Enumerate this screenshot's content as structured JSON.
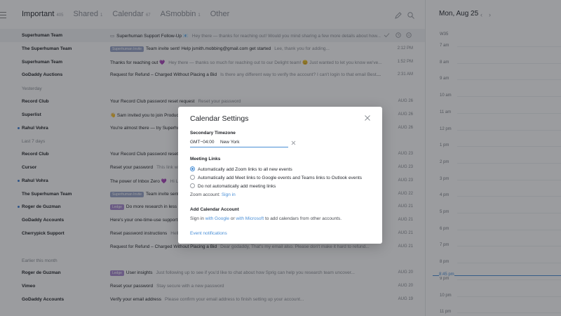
{
  "colors": {
    "accent": "#4a8fd6",
    "unread_dot": "#3f7fd4",
    "label_blue": "#9aa6c9",
    "label_purple": "#a98bd1"
  },
  "header": {
    "tabs": [
      {
        "label": "Important",
        "count": "405"
      },
      {
        "label": "Shared",
        "count": "1"
      },
      {
        "label": "Calendar",
        "count": "67"
      },
      {
        "label": "ASmobbin",
        "count": "1"
      },
      {
        "label": "Other",
        "count": ""
      }
    ]
  },
  "inbox": {
    "top": [
      {
        "sender": "Superhuman Team",
        "label": "",
        "subject": "Superhuman Support Follow-Up 📧",
        "preview": "Hey there — thanks for reaching out! Would you mind sharing a few more details about how...",
        "date": "",
        "highlight": true,
        "unread": false,
        "icon": "message-icon"
      },
      {
        "sender": "The Superhuman Team",
        "label": "Superhuman Invite",
        "subject": "Team invite sent! Help jsmith.mobbing@gmail.com get started",
        "preview": "Lee, thank you for adding...",
        "date": "2:12 PM"
      },
      {
        "sender": "Superhuman Team",
        "label": "",
        "subject": "Thanks for reaching out 💜",
        "preview": "Hey there — thanks so much for reaching out to our Delight team! 😊 Just wanted to let you know we've...",
        "date": "1:52 PM"
      },
      {
        "sender": "GoDaddy Auctions",
        "label": "",
        "subject": "Request for Refund – Charged Without Placing a Bid",
        "preview": "Is there any different way to verify the account? I can't login to that email Best, Alex...",
        "date": "2:31 AM"
      }
    ],
    "yesterday_label": "Yesterday",
    "yesterday": [
      {
        "sender": "Record Club",
        "label": "",
        "subject": "Your Record Club password reset request",
        "preview": "Reset your password",
        "date": "AUG 26"
      },
      {
        "sender": "Superlist",
        "label": "",
        "subject": "👋 Sam invited you to join Product",
        "preview": "Hi Lee, you've been invited",
        "date": "AUG 26"
      },
      {
        "sender": "Rahul Vohra",
        "label": "",
        "subject": "You're almost there — try Superhuman",
        "preview": "",
        "date": "AUG 26",
        "unread": true
      }
    ],
    "last7_label": "Last 7 days",
    "last7": [
      {
        "sender": "Record Club",
        "label": "",
        "subject": "Your Record Club password reset request",
        "preview": "Reset your password",
        "date": "AUG 23"
      },
      {
        "sender": "Cursor",
        "label": "",
        "subject": "Reset your password",
        "preview": "This link will expire",
        "date": "AUG 23"
      },
      {
        "sender": "Rahul Vohra",
        "label": "",
        "subject": "The power of Inbox Zero 💜",
        "preview": "Hi Lee, Inbox Zero",
        "date": "AUG 23",
        "unread": true
      },
      {
        "sender": "The Superhuman Team",
        "label": "Superhuman Invite",
        "subject": "Team invite sent! Help",
        "preview": "",
        "date": "AUG 22"
      },
      {
        "sender": "Roger de Guzman",
        "label": "Ledge",
        "subject": "Do more research in less time",
        "preview": "",
        "date": "AUG 21",
        "unread": true,
        "purple": true
      },
      {
        "sender": "GoDaddy Accounts",
        "label": "",
        "subject": "Here's your one-time-use support code",
        "preview": "",
        "date": "AUG 21"
      },
      {
        "sender": "Cherrypick Support",
        "label": "",
        "subject": "Reset password instructions",
        "preview": "Hello jsmith.mobbing@gmail.com Someone has requested a link to change your Cherrypick password...",
        "date": "AUG 21"
      },
      {
        "sender": "",
        "label": "",
        "subject": "Request for Refund – Charged Without Placing a Bid",
        "preview": "Dear godaddy, That's my email also. Please don't make it hard to refund...",
        "date": "AUG 21"
      }
    ],
    "earlier_label": "Earlier this month",
    "earlier": [
      {
        "sender": "Roger de Guzman",
        "label": "Ledge",
        "subject": "User insights",
        "preview": "Just following up to see if you'd like to chat about how Sprig can help you research team uncover...",
        "date": "AUG 20",
        "purple": true
      },
      {
        "sender": "Vimeo",
        "label": "",
        "subject": "Reset your password",
        "preview": "Stay secure with a new password",
        "date": "AUG 20"
      },
      {
        "sender": "GoDaddy Accounts",
        "label": "",
        "subject": "Verify your email address",
        "preview": "Please confirm your email address to finish setting up your account...",
        "date": "AUG 19"
      }
    ]
  },
  "calendar": {
    "title": "Mon, Aug 25",
    "week": "W35",
    "hours": [
      "7 am",
      "8 am",
      "9 am",
      "10 am",
      "11 am",
      "12 pm",
      "1 pm",
      "2 pm",
      "3 pm",
      "4 pm",
      "5 pm",
      "6 pm",
      "7 pm",
      "8 pm",
      "9 pm",
      "10 pm",
      "11 pm"
    ],
    "now": "8:45 pm"
  },
  "modal": {
    "title": "Calendar Settings",
    "tz_heading": "Secondary Timezone",
    "tz_offset": "GMT−04:00",
    "tz_city": "New York",
    "links_heading": "Meeting Links",
    "options": [
      {
        "label": "Automatically add Zoom links to all new events",
        "selected": true
      },
      {
        "label": "Automatically add Meet links to Google events and Teams links to Outlook events",
        "selected": false
      },
      {
        "label": "Do not automatically add meeting links",
        "selected": false
      }
    ],
    "zoom_prefix": "Zoom account:",
    "zoom_link": "Sign in",
    "add_heading": "Add Calendar Account",
    "add_pre": "Sign in",
    "add_google": "with Google",
    "add_or": "or",
    "add_microsoft": "with Microsoft",
    "add_post": "to add calendars from other accounts.",
    "notifications": "Event notifications"
  }
}
